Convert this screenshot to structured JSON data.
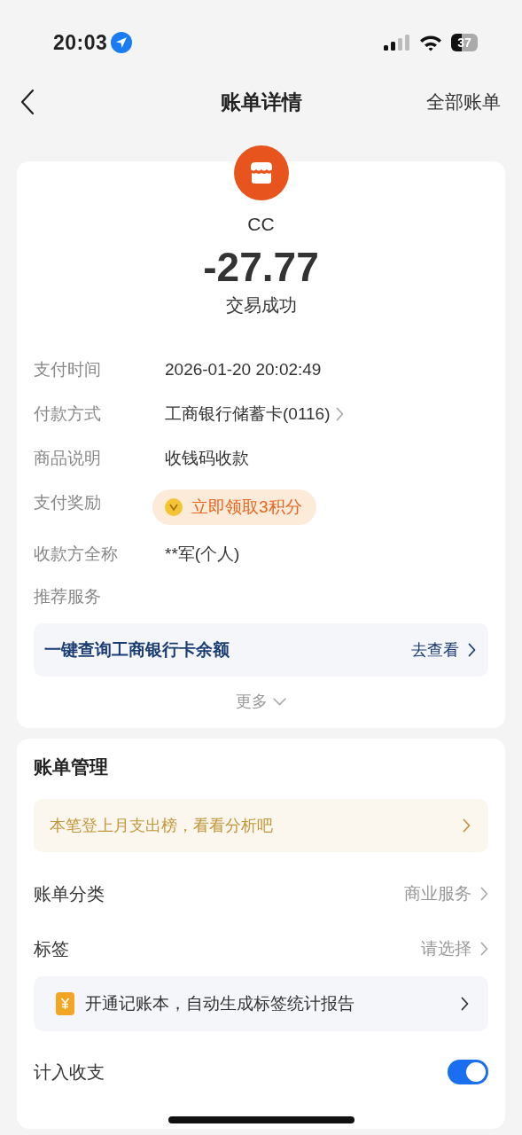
{
  "status_bar": {
    "time": "20:03",
    "battery": "37"
  },
  "nav": {
    "title": "账单详情",
    "action": "全部账单"
  },
  "bill": {
    "merchant": "CC",
    "amount": "-27.77",
    "status": "交易成功",
    "details": [
      {
        "kind": "text",
        "label": "支付时间",
        "value": "2026-01-20 20:02:49"
      },
      {
        "kind": "link",
        "label": "付款方式",
        "value": "工商银行储蓄卡(0116)"
      },
      {
        "kind": "text",
        "label": "商品说明",
        "value": "收钱码收款"
      },
      {
        "kind": "reward",
        "label": "支付奖励",
        "value": "立即领取3积分"
      },
      {
        "kind": "text",
        "label": "收款方全称",
        "value": "**军(个人)"
      },
      {
        "kind": "heading",
        "label": "推荐服务"
      }
    ],
    "service": {
      "text": "一键查询工商银行卡余额",
      "action": "去查看"
    },
    "more": "更多"
  },
  "management": {
    "title": "账单管理",
    "banner": "本笔登上月支出榜，看看分析吧",
    "rows": [
      {
        "label": "账单分类",
        "value": "商业服务"
      },
      {
        "label": "标签",
        "value": "请选择"
      }
    ],
    "promo": "开通记账本，自动生成标签统计报告",
    "toggle": {
      "label": "计入收支",
      "on": true
    }
  }
}
